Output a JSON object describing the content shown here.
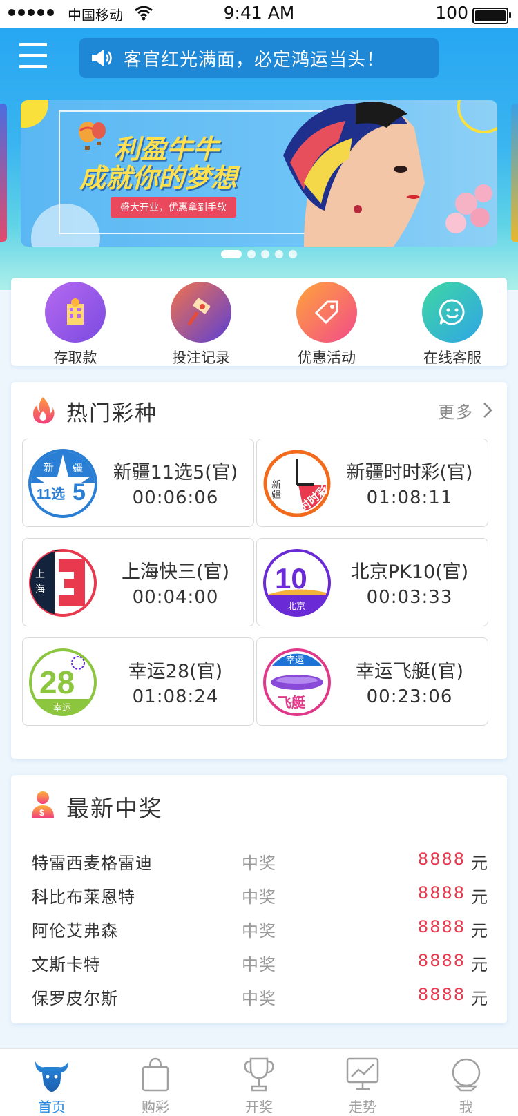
{
  "status_bar": {
    "carrier": "中国移动",
    "time": "9:41 AM",
    "battery": "100"
  },
  "header": {
    "notice": "客官红光满面，必定鸿运当头！"
  },
  "banner": {
    "title_line1": "利盈牛牛",
    "title_line2": "成就你的梦想",
    "tag": "盛大开业，优惠拿到手软",
    "active_dot": 0,
    "dot_count": 5
  },
  "quick_actions": [
    {
      "label": "存取款",
      "icon": "bank-building-icon"
    },
    {
      "label": "投注记录",
      "icon": "hammer-record-icon"
    },
    {
      "label": "优惠活动",
      "icon": "price-tag-icon"
    },
    {
      "label": "在线客服",
      "icon": "smiley-chat-icon"
    }
  ],
  "hot": {
    "title": "热门彩种",
    "more": "更多",
    "games": [
      {
        "name": "新疆11选5(官)",
        "time": "00:06:06",
        "logo_text": [
          "新",
          "疆",
          "11选",
          "5"
        ]
      },
      {
        "name": "新疆时时彩(官)",
        "time": "01:08:11",
        "logo_text": [
          "新疆",
          "时时彩"
        ]
      },
      {
        "name": "上海快三(官)",
        "time": "00:04:00",
        "logo_text": [
          "上",
          "海"
        ]
      },
      {
        "name": "北京PK10(官)",
        "time": "00:03:33",
        "logo_text": [
          "10",
          "北京"
        ]
      },
      {
        "name": "幸运28(官)",
        "time": "01:08:24",
        "logo_text": [
          "28",
          "幸运"
        ]
      },
      {
        "name": "幸运飞艇(官)",
        "time": "00:23:06",
        "logo_text": [
          "幸运",
          "飞艇"
        ]
      }
    ]
  },
  "winners": {
    "title": "最新中奖",
    "rows": [
      {
        "name": "特雷西麦格雷迪",
        "label": "中奖",
        "amount": "8888",
        "unit": "元"
      },
      {
        "name": "科比布莱恩特",
        "label": "中奖",
        "amount": "8888",
        "unit": "元"
      },
      {
        "name": "阿伦艾弗森",
        "label": "中奖",
        "amount": "8888",
        "unit": "元"
      },
      {
        "name": "文斯卡特",
        "label": "中奖",
        "amount": "8888",
        "unit": "元"
      },
      {
        "name": "保罗皮尔斯",
        "label": "中奖",
        "amount": "8888",
        "unit": "元"
      }
    ]
  },
  "tabs": [
    {
      "label": "首页",
      "icon": "bull-head-icon",
      "active": true
    },
    {
      "label": "购彩",
      "icon": "shopping-bag-icon",
      "active": false
    },
    {
      "label": "开奖",
      "icon": "trophy-icon",
      "active": false
    },
    {
      "label": "走势",
      "icon": "trend-chart-icon",
      "active": false
    },
    {
      "label": "我",
      "icon": "user-icon",
      "active": false
    }
  ],
  "colors": {
    "primary": "#27a6f2",
    "accent_red": "#e8394f",
    "tab_active": "#2a8be0"
  }
}
